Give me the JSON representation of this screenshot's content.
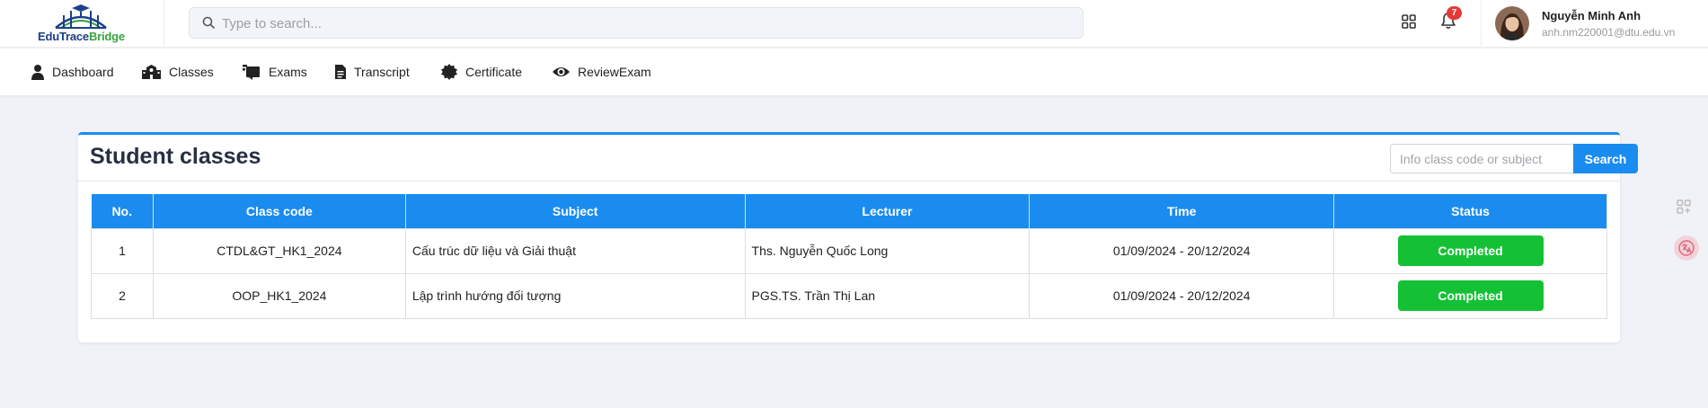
{
  "brand": {
    "name_part1": "EduTrace",
    "name_part2": "Bridge"
  },
  "search": {
    "placeholder": "Type to search..."
  },
  "notifications": {
    "count": "7"
  },
  "user": {
    "name": "Nguyễn Minh Anh",
    "email": "anh.nm220001@dtu.edu.vn"
  },
  "nav": [
    {
      "label": "Dashboard",
      "icon": "user-icon"
    },
    {
      "label": "Classes",
      "icon": "school-icon"
    },
    {
      "label": "Exams",
      "icon": "exam-icon"
    },
    {
      "label": "Transcript",
      "icon": "document-icon"
    },
    {
      "label": "Certificate",
      "icon": "certificate-icon"
    },
    {
      "label": "ReviewExam",
      "icon": "eye-icon"
    }
  ],
  "card": {
    "title": "Student classes",
    "search_placeholder": "Info class code or subject",
    "search_button": "Search"
  },
  "table": {
    "headers": [
      "No.",
      "Class code",
      "Subject",
      "Lecturer",
      "Time",
      "Status"
    ],
    "rows": [
      {
        "no": "1",
        "code": "CTDL&GT_HK1_2024",
        "subject": "Cấu trúc dữ liệu và Giải thuật",
        "lecturer": "Ths. Nguyễn Quốc Long",
        "time": "01/09/2024 - 20/12/2024",
        "status": "Completed"
      },
      {
        "no": "2",
        "code": "OOP_HK1_2024",
        "subject": "Lập trình hướng đối tượng",
        "lecturer": "PGS.TS. Trần Thị Lan",
        "time": "01/09/2024 - 20/12/2024",
        "status": "Completed"
      }
    ]
  },
  "colors": {
    "primary": "#1a8cf0",
    "success": "#14c134",
    "badge_red": "#e53935",
    "background": "#f1f2f8"
  }
}
